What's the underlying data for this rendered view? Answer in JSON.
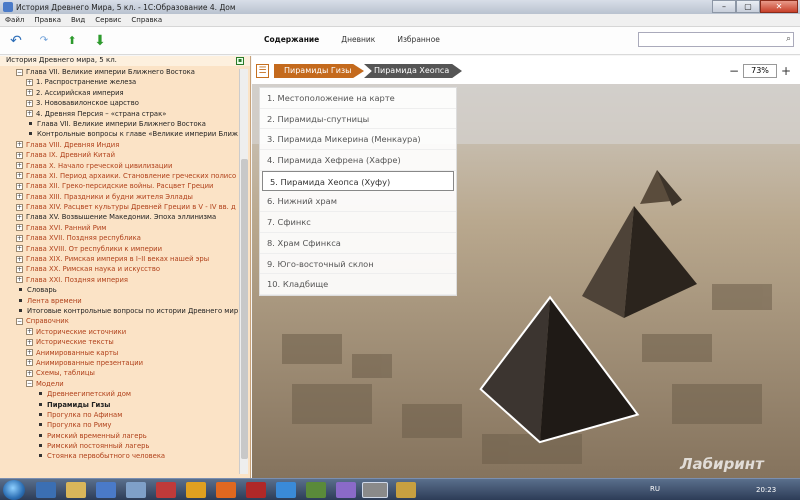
{
  "window": {
    "title": "История Древнего Мира, 5 кл. - 1С:Образование 4. Дом",
    "minimize": "–",
    "maximize": "▢",
    "close": "✕"
  },
  "menu": [
    "Файл",
    "Правка",
    "Вид",
    "Сервис",
    "Справка"
  ],
  "toolbar": {
    "tabs": [
      "Содержание",
      "Дневник",
      "Избранное"
    ],
    "active_tab": "Содержание",
    "search_value": ""
  },
  "sidebar": {
    "title": "История Древнего мира, 5 кл.",
    "rows": [
      {
        "indent": 1,
        "type": "minus",
        "label": "Глава VII. Великие империи Ближнего Востока",
        "style": ""
      },
      {
        "indent": 2,
        "type": "plus",
        "label": "1. Распространение железа",
        "style": ""
      },
      {
        "indent": 2,
        "type": "plus",
        "label": "2. Ассирийская империя",
        "style": ""
      },
      {
        "indent": 2,
        "type": "plus",
        "label": "3. Нововавилонское царство",
        "style": ""
      },
      {
        "indent": 2,
        "type": "plus",
        "label": "4. Древняя Персия – «страна страк»",
        "style": ""
      },
      {
        "indent": 2,
        "type": "bullet",
        "label": "Глава VII. Великие империи Ближнего Востока",
        "style": ""
      },
      {
        "indent": 2,
        "type": "bullet",
        "label": "Контрольные вопросы к главе «Великие империи Ближ",
        "style": ""
      },
      {
        "indent": 1,
        "type": "plus",
        "label": "Глава VIII. Древняя Индия",
        "style": "red"
      },
      {
        "indent": 1,
        "type": "plus",
        "label": "Глава IX. Древний Китай",
        "style": "red"
      },
      {
        "indent": 1,
        "type": "plus",
        "label": "Глава X. Начало греческой цивилизации",
        "style": "red"
      },
      {
        "indent": 1,
        "type": "plus",
        "label": "Глава XI. Период архаики. Становление греческих полисо",
        "style": "red"
      },
      {
        "indent": 1,
        "type": "plus",
        "label": "Глава XII. Греко-персидские войны. Расцвет Греции",
        "style": "red"
      },
      {
        "indent": 1,
        "type": "plus",
        "label": "Глава XIII. Праздники и будни жителя Эллады",
        "style": "red"
      },
      {
        "indent": 1,
        "type": "plus",
        "label": "Глава XIV. Расцвет культуры Древней Греции в V - IV вв. д",
        "style": "red"
      },
      {
        "indent": 1,
        "type": "plus",
        "label": "Глава XV. Возвышение Македонии. Эпоха эллинизма",
        "style": ""
      },
      {
        "indent": 1,
        "type": "plus",
        "label": "Глава XVI. Ранний Рим",
        "style": "red"
      },
      {
        "indent": 1,
        "type": "plus",
        "label": "Глава XVII. Поздняя республика",
        "style": "red"
      },
      {
        "indent": 1,
        "type": "plus",
        "label": "Глава XVIII. От республики к империи",
        "style": "red"
      },
      {
        "indent": 1,
        "type": "plus",
        "label": "Глава XIX. Римская империя в I–II веках нашей эры",
        "style": "red"
      },
      {
        "indent": 1,
        "type": "plus",
        "label": "Глава XX. Римская наука и искусство",
        "style": "red"
      },
      {
        "indent": 1,
        "type": "plus",
        "label": "Глава XXI. Поздняя империя",
        "style": "red"
      },
      {
        "indent": 1,
        "type": "bullet",
        "label": "Словарь",
        "style": ""
      },
      {
        "indent": 1,
        "type": "bullet",
        "label": "Лента времени",
        "style": "red"
      },
      {
        "indent": 1,
        "type": "bullet",
        "label": "Итоговые контрольные вопросы по истории Древнего мира",
        "style": ""
      },
      {
        "indent": 1,
        "type": "minus",
        "label": "Справочник",
        "style": "red"
      },
      {
        "indent": 2,
        "type": "plus",
        "label": "Исторические источники",
        "style": "red"
      },
      {
        "indent": 2,
        "type": "plus",
        "label": "Исторические тексты",
        "style": "red"
      },
      {
        "indent": 2,
        "type": "plus",
        "label": "Анимированные карты",
        "style": "red"
      },
      {
        "indent": 2,
        "type": "plus",
        "label": "Анимированные презентации",
        "style": "red"
      },
      {
        "indent": 2,
        "type": "plus",
        "label": "Схемы, таблицы",
        "style": "red"
      },
      {
        "indent": 2,
        "type": "minus",
        "label": "Модели",
        "style": "red"
      },
      {
        "indent": 3,
        "type": "bullet",
        "label": "Древнеегипетский дом",
        "style": "red"
      },
      {
        "indent": 3,
        "type": "bullet",
        "label": "Пирамиды Гизы",
        "style": "bold"
      },
      {
        "indent": 3,
        "type": "bullet",
        "label": "Прогулка по Афинам",
        "style": "red"
      },
      {
        "indent": 3,
        "type": "bullet",
        "label": "Прогулка по Риму",
        "style": "red"
      },
      {
        "indent": 3,
        "type": "bullet",
        "label": "Римский временный лагерь",
        "style": "red"
      },
      {
        "indent": 3,
        "type": "bullet",
        "label": "Римский постоянный лагерь",
        "style": "red"
      },
      {
        "indent": 3,
        "type": "bullet",
        "label": "Стоянка первобытного человека",
        "style": "red"
      }
    ]
  },
  "main": {
    "breadcrumbs": [
      "Пирамиды Гизы",
      "Пирамида Хеопса"
    ],
    "zoom": "73%",
    "objects": [
      "1. Местоположение на карте",
      "2. Пирамиды-спутницы",
      "3. Пирамида Микерина (Менкаура)",
      "4. Пирамида Хефрена (Хафре)",
      "5. Пирамида Хеопса (Хуфу)",
      "6. Нижний храм",
      "7. Сфинкс",
      "8. Храм Сфинкса",
      "9. Юго-восточный склон",
      "10. Кладбище"
    ],
    "selected_index": 4
  },
  "taskbar": {
    "lang": "RU",
    "time": "20:23"
  },
  "watermark": "Лабиринт"
}
